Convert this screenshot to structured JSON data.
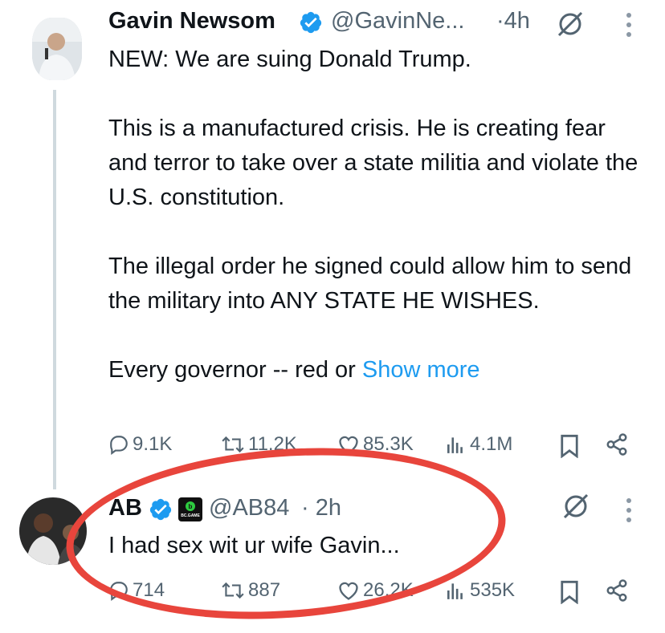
{
  "tweet1": {
    "name": "Gavin Newsom",
    "handle": "@GavinNe...",
    "time": "·4h",
    "text": "NEW: We are suing Donald Trump.\n\nThis is a manufactured crisis. He is creating fear and terror to take over a state militia and violate the U.S. constitution.\n\nThe illegal order he signed could allow him to send the military into ANY STATE HE WISHES.\n\nEvery governor -- red or ",
    "show_more": "Show more",
    "replies": "9.1K",
    "reposts": "11.2K",
    "likes": "85.3K",
    "views": "4.1M"
  },
  "tweet2": {
    "name": "AB",
    "handle": "@AB84",
    "time": "· 2h",
    "badge_text": "BC.GAME",
    "text": "I had sex wit ur wife Gavin...",
    "replies": "714",
    "reposts": "887",
    "likes": "26.2K",
    "views": "535K"
  },
  "colors": {
    "verified": "#1d9bf0",
    "annotation": "#e8453c",
    "muted": "#536471"
  },
  "icons": [
    "verified-icon",
    "grok-icon",
    "more-icon",
    "reply-icon",
    "repost-icon",
    "like-icon",
    "views-icon",
    "bookmark-icon",
    "share-icon"
  ]
}
